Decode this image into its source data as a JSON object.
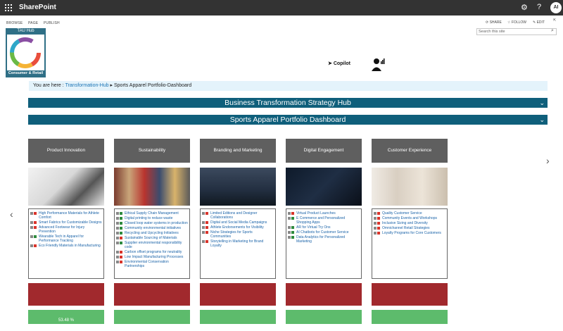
{
  "topbar": {
    "app_title": "SharePoint",
    "avatar_initials": "AI"
  },
  "ribbon": {
    "tabs": [
      "BROWSE",
      "PAGE",
      "PUBLISH"
    ],
    "share": "SHARE",
    "follow": "FOLLOW",
    "edit": "EDIT"
  },
  "search": {
    "placeholder": "Search this site"
  },
  "logo": {
    "title": "TAU Hub",
    "footer": "Consumer & Retail"
  },
  "copilot_label": "Copilot",
  "breadcrumb": {
    "prefix": "You are here :",
    "link": "Transformation-Hub",
    "separator": "▸",
    "current": "Sports Apparel Portfolio-Dashboard"
  },
  "banners": [
    "Business Transformation Strategy Hub",
    "Sports Apparel Portfolio Dashboard"
  ],
  "columns": [
    {
      "title": "Product Innovation",
      "items": [
        {
          "text": "High Performance Materials for Athlete Comfort",
          "status": "#d9342b"
        },
        {
          "text": "Smart Fabrics for Customizable Designs",
          "status": "#d9342b"
        },
        {
          "text": "Advanced Footwear for Injury Prevention",
          "status": "#d9342b"
        },
        {
          "text": "Wearable Tech in Apparel for Performance Tracking",
          "status": "#2e8b3e"
        },
        {
          "text": "Eco Friendly Materials in Manufacturing",
          "status": "#d9342b"
        }
      ]
    },
    {
      "title": "Sustainability",
      "items": [
        {
          "text": "Ethical Supply Chain Management",
          "status": "#2e8b3e"
        },
        {
          "text": "Digital printing to reduce waste",
          "status": "#2e8b3e"
        },
        {
          "text": "Closed loop water systems in production",
          "status": "#2e8b3e"
        },
        {
          "text": "Community environmental initiatives",
          "status": "#2e8b3e"
        },
        {
          "text": "Recycling and Upcycling Initiatives",
          "status": "#2e8b3e"
        },
        {
          "text": "Sustainable Sourcing of Materials",
          "status": "#d9342b"
        },
        {
          "text": "Supplier environmental responsibility code",
          "status": "#2e8b3e"
        },
        {
          "text": "Carbon offset programs for neutrality",
          "status": "#d9342b"
        },
        {
          "text": "Low Impact Manufacturing Processes",
          "status": "#d9342b"
        },
        {
          "text": "Environmental Conservation Partnerships",
          "status": "#d9342b"
        }
      ]
    },
    {
      "title": "Branding and Marketing",
      "items": [
        {
          "text": "Limited Editions and Designer Collaborations",
          "status": "#d9342b"
        },
        {
          "text": "Digital and Social Media Campaigns",
          "status": "#d9342b"
        },
        {
          "text": "Athlete Endorsements for Visibility",
          "status": "#d9342b"
        },
        {
          "text": "Niche Strategies for Sports Communities",
          "status": "#d9342b"
        },
        {
          "text": "Storytelling in Marketing for Brand Loyalty",
          "status": "#d9342b"
        }
      ]
    },
    {
      "title": "Digital Engagement",
      "items": [
        {
          "text": "Virtual Product Launches",
          "status": "#d9342b"
        },
        {
          "text": "E Commerce and Personalized Shopping Apps",
          "status": "#2e8b3e"
        },
        {
          "text": "AR for Virtual Try Ons",
          "status": "#2e8b3e"
        },
        {
          "text": "AI Chatbots for Customer Service",
          "status": "#2e8b3e"
        },
        {
          "text": "Data Analytics for Personalized Marketing",
          "status": "#2e8b3e"
        }
      ]
    },
    {
      "title": "Customer Experience",
      "items": [
        {
          "text": "Quality Customer Service",
          "status": "#d9342b"
        },
        {
          "text": "Community Events and Workshops",
          "status": "#d9342b"
        },
        {
          "text": "Inclusive Sizing and Diversity",
          "status": "#d9342b"
        },
        {
          "text": "Omnichannel Retail Strategies",
          "status": "#d9342b"
        },
        {
          "text": "Loyalty Programs for Core Customers",
          "status": "#d9342b"
        }
      ]
    }
  ],
  "progress": [
    {
      "label": "53.48 %"
    },
    {
      "label": ""
    },
    {
      "label": ""
    },
    {
      "label": ""
    },
    {
      "label": ""
    }
  ],
  "colors": {
    "banner": "#0f5f7b",
    "header_tile": "#5f5f5f",
    "red_tile": "#a1292d",
    "green_tile": "#5dbb6c",
    "breadcrumb_bg": "#e4f3fb"
  }
}
